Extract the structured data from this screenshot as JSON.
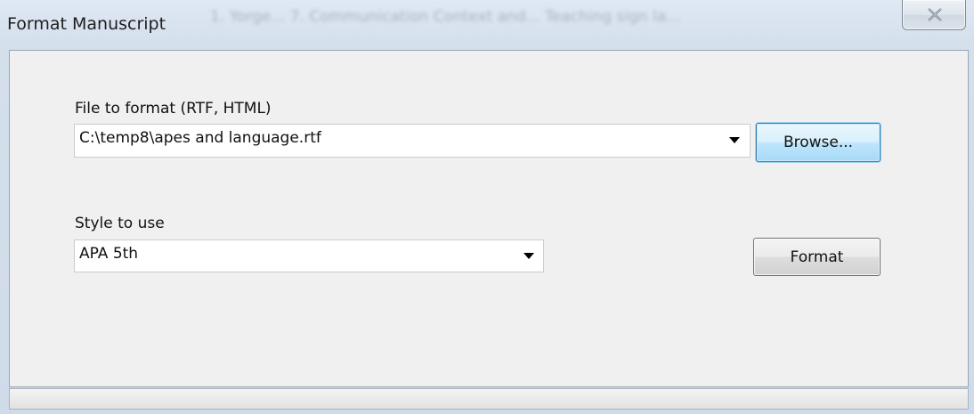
{
  "window": {
    "title": "Format Manuscript",
    "background_title": "1. Yorge... 7. Communication Context and... Teaching sign la..."
  },
  "file_section": {
    "label": "File to format (RTF, HTML)",
    "value": "C:\\temp8\\apes and language.rtf",
    "browse_label": "Browse..."
  },
  "style_section": {
    "label": "Style to use",
    "value": "APA 5th",
    "format_label": "Format"
  },
  "icons": {
    "close": "close-icon",
    "dropdown": "chevron-down-icon"
  },
  "colors": {
    "focus_accent": "#3c7fb1",
    "client_bg": "#f0f0f0",
    "frame": "#d4dfec"
  }
}
